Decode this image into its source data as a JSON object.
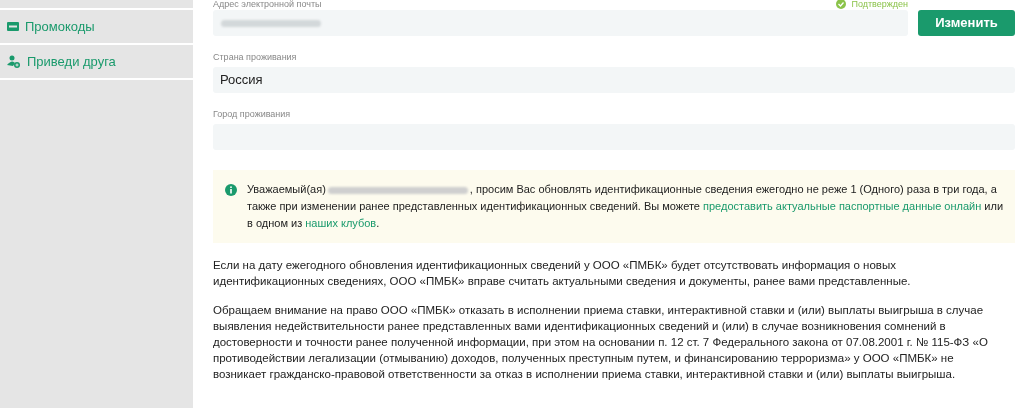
{
  "sidebar": {
    "items": [
      {
        "label": "Промокоды",
        "kind": "ticket"
      },
      {
        "label": "Приведи друга",
        "kind": "invite"
      }
    ]
  },
  "email": {
    "label": "Адрес электронной почты",
    "status": "Подтвержден",
    "verified": true,
    "button": "Изменить"
  },
  "country": {
    "label": "Страна проживания",
    "value": "Россия"
  },
  "city": {
    "label": "Город проживания"
  },
  "notice": {
    "parts": [
      {
        "kind": "text",
        "text": "Уважаемый(ая)"
      },
      {
        "kind": "redacted"
      },
      {
        "kind": "text",
        "text": ", просим Вас обновлять идентификационные сведения ежегодно не реже 1 (Одного) раза в три года, а также при изменении ранее представленных идентификационных сведений. Вы можете "
      },
      {
        "kind": "link",
        "text": "предоставить актуальные паспортные данные онлайн"
      },
      {
        "kind": "text",
        "text": " или в одном из "
      },
      {
        "kind": "link",
        "text": "наших клубов"
      },
      {
        "kind": "text",
        "text": "."
      }
    ]
  },
  "paragraphs": [
    "Если на дату ежегодного обновления идентификационных сведений у ООО «ПМБК» будет отсутствовать информация о новых идентификационных сведениях, ООО «ПМБК» вправе считать актуальными сведения и документы, ранее вами представленные.",
    "Обращаем внимание на право ООО «ПМБК» отказать в исполнении приема ставки, интерактивной ставки и (или) выплаты выигрыша в случае выявления недействительности ранее представленных вами идентификационных сведений и (или) в случае возникновения сомнений в достоверности и точности ранее полученной информации, при этом на основании п. 12 ст. 7 Федерального закона от 07.08.2001 г. № 115-ФЗ «О противодействии легализации (отмыванию) доходов, полученных преступным путем, и финансированию терроризма» у ООО «ПМБК» не возникает гражданско-правовой ответственности за отказ в исполнении приема ставки, интерактивной ставки и (или) выплаты выигрыша."
  ]
}
